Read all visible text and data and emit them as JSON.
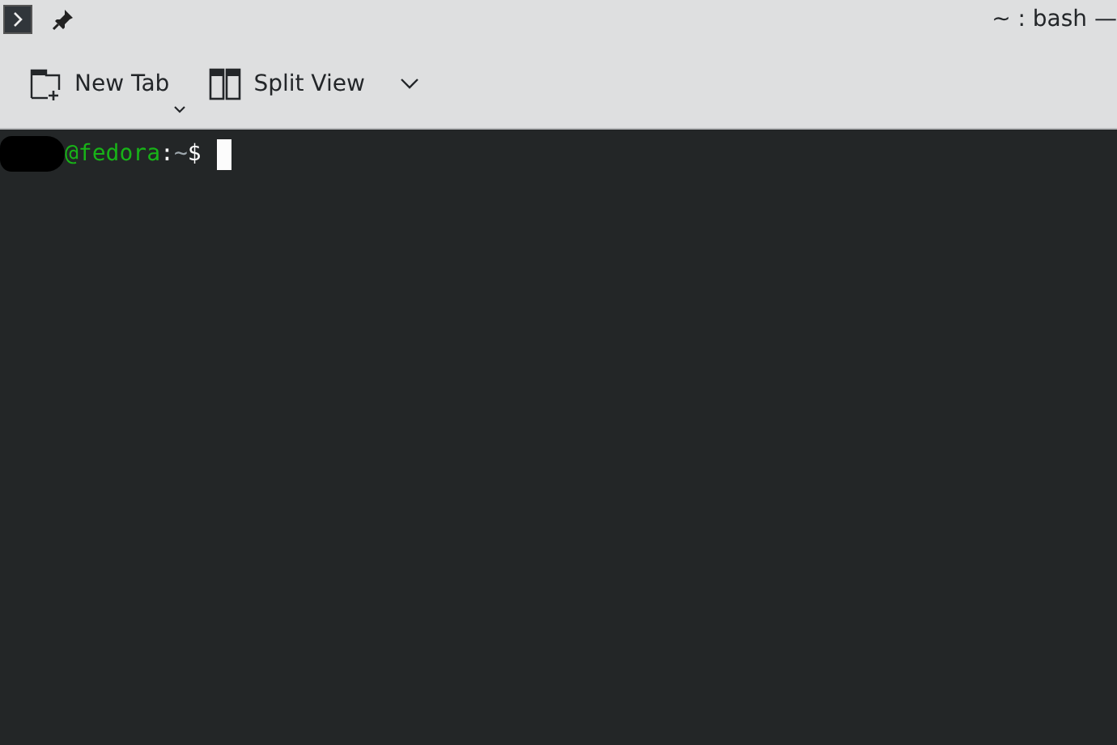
{
  "window": {
    "title": "~ : bash —"
  },
  "toolbar": [
    {
      "kind": "new-tab",
      "label": "New Tab",
      "menu_indicator": true
    },
    {
      "kind": "split-view",
      "label": "Split View",
      "dropdown": true
    }
  ],
  "terminal": {
    "prompt": [
      {
        "kind": "redacted"
      },
      {
        "kind": "host",
        "text": "@fedora"
      },
      {
        "kind": "plain",
        "text": ":"
      },
      {
        "kind": "path",
        "text": "~"
      },
      {
        "kind": "plain",
        "text": "$"
      }
    ],
    "cursor": true
  }
}
